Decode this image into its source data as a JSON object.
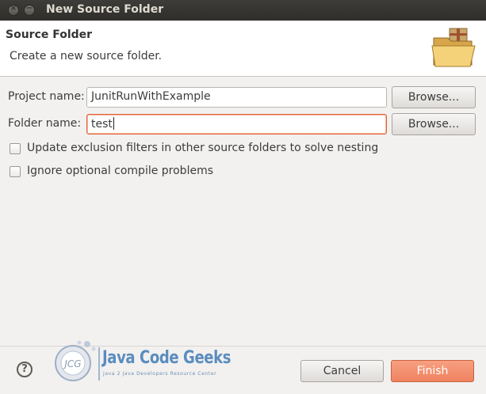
{
  "window": {
    "title": "New Source Folder",
    "controls": [
      "close-icon",
      "minimize-icon"
    ]
  },
  "banner": {
    "heading": "Source Folder",
    "description": "Create a new source folder.",
    "icon": "folder-package-icon"
  },
  "form": {
    "project": {
      "label": "Project name:",
      "value": "JunitRunWithExample",
      "browse_label": "Browse..."
    },
    "folder": {
      "label": "Folder name:",
      "value": "test",
      "browse_label": "Browse..."
    },
    "options": [
      {
        "label": "Update exclusion filters in other source folders to solve nesting",
        "checked": false
      },
      {
        "label": "Ignore optional compile problems",
        "checked": false
      }
    ]
  },
  "footer": {
    "help_symbol": "?",
    "cancel_label": "Cancel",
    "finish_label": "Finish"
  },
  "watermark": {
    "brand": "Java Code Geeks",
    "tagline": "Java 2 Java Developers Resource Center",
    "badge": "JCG"
  },
  "colors": {
    "accent": "#ef8260",
    "titlebar": "#3d3c38",
    "background": "#f2f1f0",
    "logo_blue": "#5a8dbf"
  }
}
